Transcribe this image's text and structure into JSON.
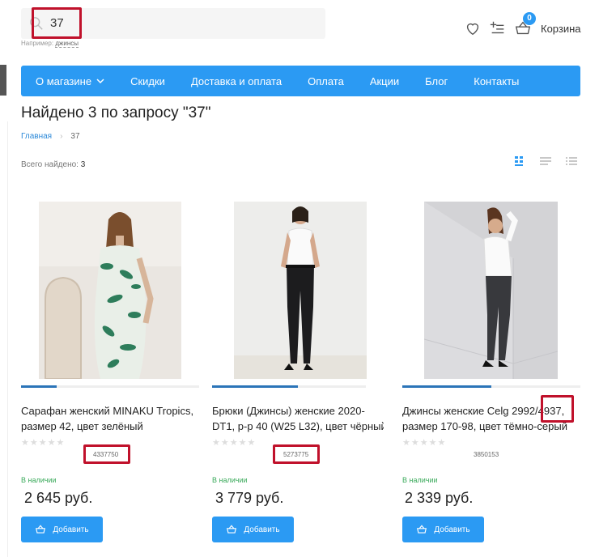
{
  "search": {
    "value": "37",
    "hint_prefix": "Например:",
    "hint_example": "джинсы"
  },
  "header": {
    "cart_count": "0",
    "cart_label": "Корзина"
  },
  "nav": {
    "items": [
      {
        "label": "О магазине"
      },
      {
        "label": "Скидки"
      },
      {
        "label": "Доставка и оплата"
      },
      {
        "label": "Оплата"
      },
      {
        "label": "Акции"
      },
      {
        "label": "Блог"
      },
      {
        "label": "Контакты"
      }
    ]
  },
  "page_title": "Найдено 3 по запросу \"37\"",
  "breadcrumb": {
    "home": "Главная",
    "current": "37"
  },
  "results": {
    "label": "Всего найдено:",
    "count": "3"
  },
  "products": [
    {
      "name_line1": "Сарафан женский MINAKU Tropics,",
      "name_line2": "размер 42, цвет зелёный",
      "sku": "4337750",
      "stock": "В наличии",
      "price": "2 645 руб.",
      "add_label": "Добавить",
      "image": "woman-floral-dress-photo"
    },
    {
      "name_line1": "Брюки (Джинсы) женские 2020-",
      "name_line2": "DT1, р-р 40 (W25 L32), цвет чёрный",
      "sku": "5273775",
      "stock": "В наличии",
      "price": "3 779 руб.",
      "add_label": "Добавить",
      "image": "woman-black-jeans-photo"
    },
    {
      "name_line1": "Джинсы женские Celg 2992/4937,",
      "name_line2": "размер 170-98, цвет тёмно-серый",
      "sku": "3850153",
      "stock": "В наличии",
      "price": "2 339 руб.",
      "add_label": "Добавить",
      "image": "woman-grey-jeans-photo"
    }
  ],
  "colors": {
    "accent": "#2b9af3",
    "highlight": "#c0112b",
    "in_stock": "#3aaa5b"
  }
}
